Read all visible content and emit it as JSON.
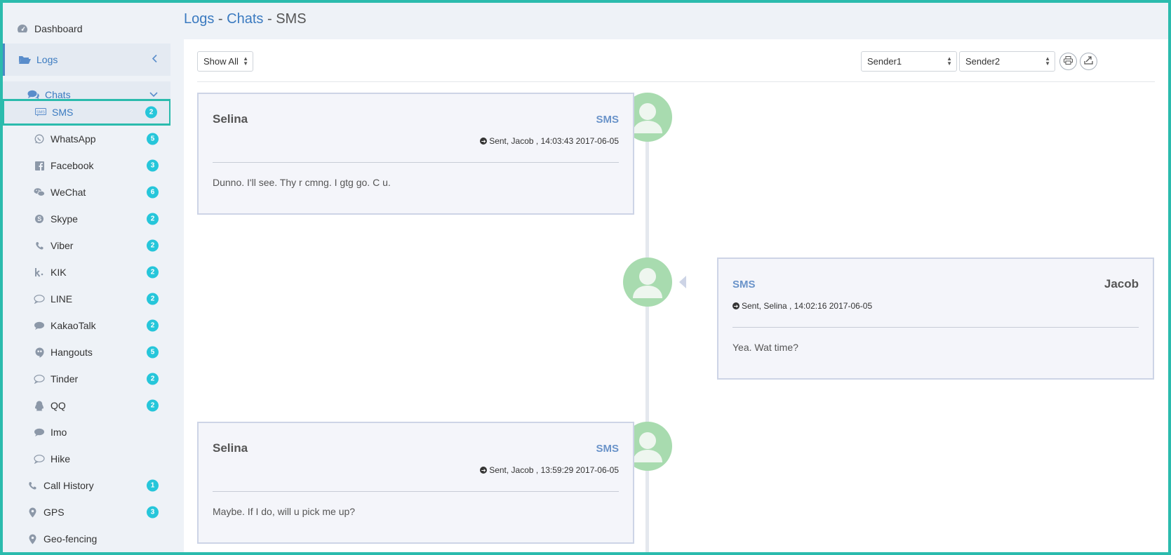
{
  "sidebar": {
    "dashboard": "Dashboard",
    "logs": "Logs",
    "chats": "Chats",
    "items": [
      {
        "label": "SMS",
        "icon": "sms-icon",
        "badge": "2"
      },
      {
        "label": "WhatsApp",
        "icon": "whatsapp-icon",
        "badge": "5"
      },
      {
        "label": "Facebook",
        "icon": "facebook-icon",
        "badge": "3"
      },
      {
        "label": "WeChat",
        "icon": "wechat-icon",
        "badge": "6"
      },
      {
        "label": "Skype",
        "icon": "skype-icon",
        "badge": "2"
      },
      {
        "label": "Viber",
        "icon": "phone-icon",
        "badge": "2"
      },
      {
        "label": "KIK",
        "icon": "kik-icon",
        "badge": "2"
      },
      {
        "label": "LINE",
        "icon": "comment-outline-icon",
        "badge": "2"
      },
      {
        "label": "KakaoTalk",
        "icon": "comment-icon",
        "badge": "2"
      },
      {
        "label": "Hangouts",
        "icon": "hangouts-icon",
        "badge": "5"
      },
      {
        "label": "Tinder",
        "icon": "comment-outline-icon",
        "badge": "2"
      },
      {
        "label": "QQ",
        "icon": "qq-icon",
        "badge": "2"
      },
      {
        "label": "Imo",
        "icon": "comment-icon",
        "badge": ""
      },
      {
        "label": "Hike",
        "icon": "comment-outline-icon",
        "badge": ""
      }
    ],
    "call_history": {
      "label": "Call History",
      "badge": "1"
    },
    "gps": {
      "label": "GPS",
      "badge": "3"
    },
    "geofencing": {
      "label": "Geo-fencing"
    }
  },
  "breadcrumb": {
    "logs": "Logs",
    "sep1": " - ",
    "chats": "Chats",
    "sep2": " - ",
    "current": "SMS"
  },
  "toolbar": {
    "filter": "Show All",
    "sender1": "Sender1",
    "sender2": "Sender2"
  },
  "messages": [
    {
      "side": "left",
      "name": "Selina",
      "channel": "SMS",
      "meta": "Sent, Jacob , 14:03:43 2017-06-05",
      "text": "Dunno. I'll see. Thy r cmng. I gtg go. C u."
    },
    {
      "side": "right",
      "name": "Jacob",
      "channel": "SMS",
      "meta": "Sent, Selina , 14:02:16 2017-06-05",
      "text": "Yea. Wat time?"
    },
    {
      "side": "left",
      "name": "Selina",
      "channel": "SMS",
      "meta": "Sent, Jacob , 13:59:29 2017-06-05",
      "text": "Maybe. If I do, will u pick me up?"
    }
  ],
  "colors": {
    "accent": "#2bbbad",
    "badge": "#26c6da",
    "link": "#3a7ac0",
    "avatar": "#a8dbaf"
  }
}
